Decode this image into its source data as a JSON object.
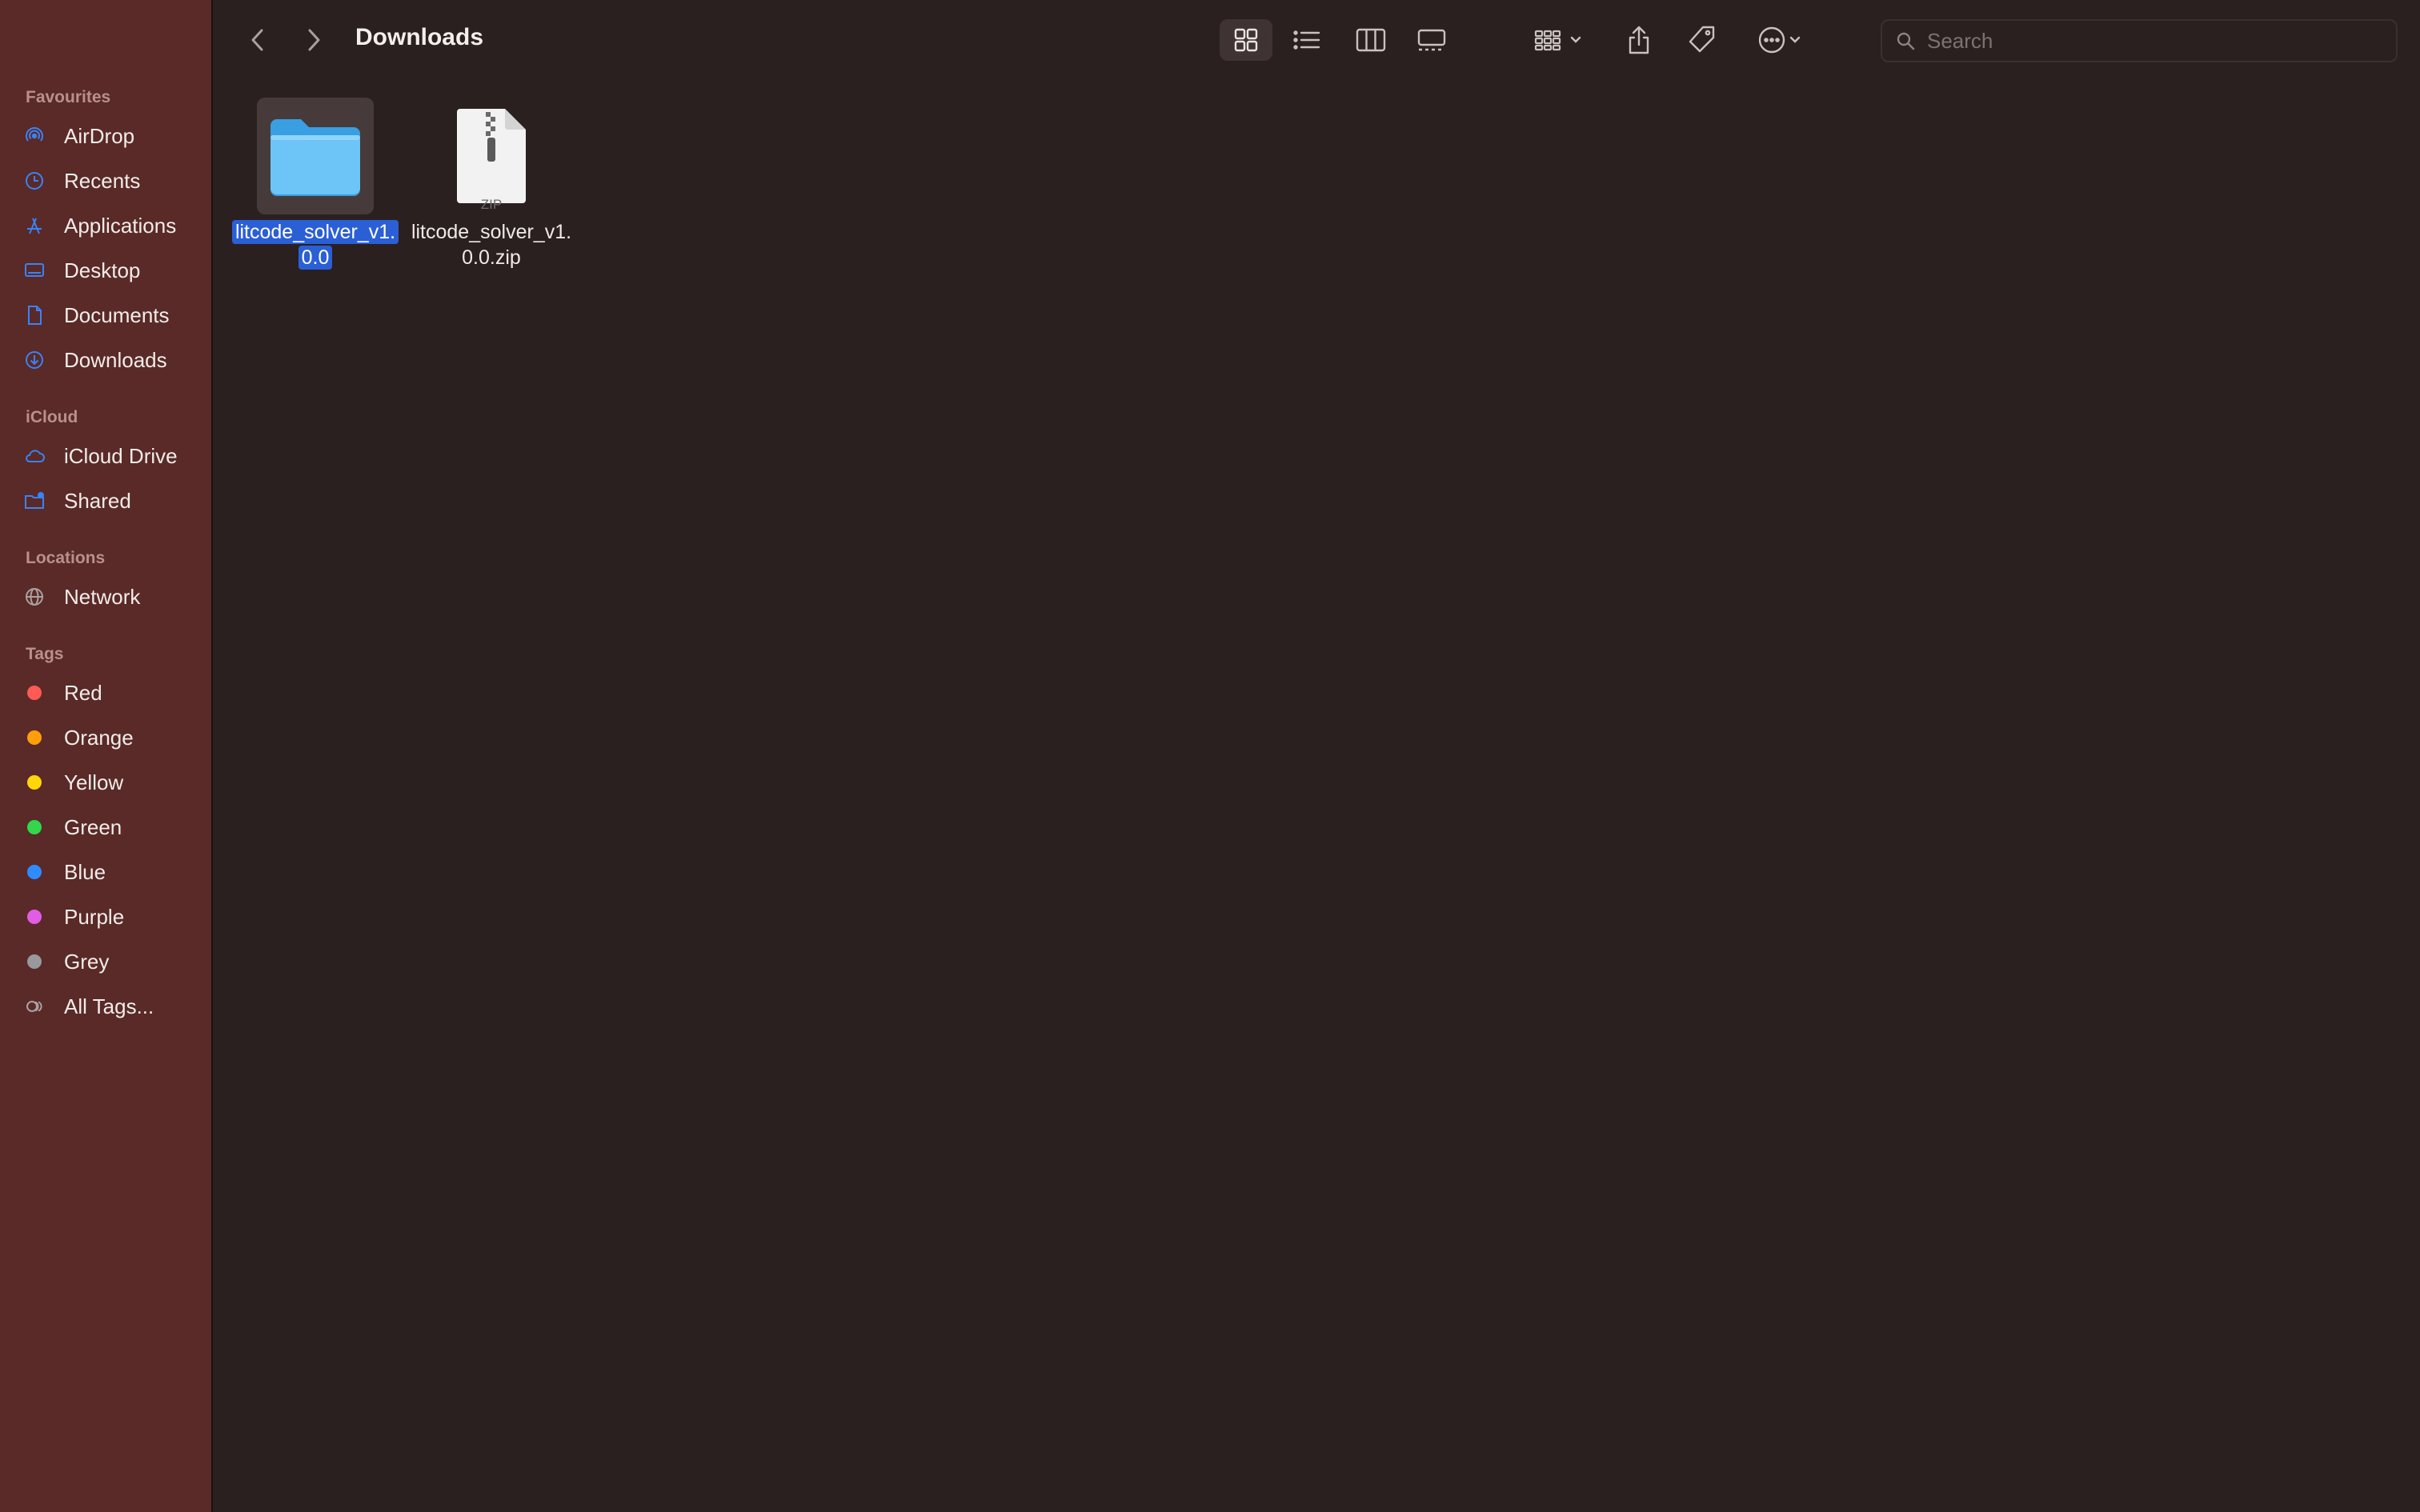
{
  "toolbar": {
    "title": "Downloads",
    "search_placeholder": "Search"
  },
  "sidebar": {
    "favourites": {
      "title": "Favourites",
      "items": [
        {
          "label": "AirDrop",
          "icon": "airdrop-icon"
        },
        {
          "label": "Recents",
          "icon": "clock-icon"
        },
        {
          "label": "Applications",
          "icon": "applications-icon"
        },
        {
          "label": "Desktop",
          "icon": "desktop-icon"
        },
        {
          "label": "Documents",
          "icon": "document-icon"
        },
        {
          "label": "Downloads",
          "icon": "download-icon"
        }
      ]
    },
    "icloud": {
      "title": "iCloud",
      "items": [
        {
          "label": "iCloud Drive",
          "icon": "cloud-icon"
        },
        {
          "label": "Shared",
          "icon": "shared-folder-icon"
        }
      ]
    },
    "locations": {
      "title": "Locations",
      "items": [
        {
          "label": "Network",
          "icon": "globe-icon"
        }
      ]
    },
    "tags": {
      "title": "Tags",
      "items": [
        {
          "label": "Red",
          "color": "#ff5a55"
        },
        {
          "label": "Orange",
          "color": "#ff9f0a"
        },
        {
          "label": "Yellow",
          "color": "#ffd60a"
        },
        {
          "label": "Green",
          "color": "#32d74b"
        },
        {
          "label": "Blue",
          "color": "#2f8cff"
        },
        {
          "label": "Purple",
          "color": "#e35ce6"
        },
        {
          "label": "Grey",
          "color": "#98989d"
        },
        {
          "label": "All Tags...",
          "icon": "all-tags-icon"
        }
      ]
    }
  },
  "files": [
    {
      "name_line1": "litcode_solver_v1.",
      "name_line2": "0.0",
      "type": "folder",
      "selected": true
    },
    {
      "name_line1": "litcode_solver_v1.",
      "name_line2": "0.0.zip",
      "type": "zip",
      "badge": "ZIP",
      "selected": false
    }
  ],
  "colors": {
    "sidebar_bg": "#592a27",
    "content_bg": "#2a201f",
    "accent_icon": "#3b82f6",
    "selection": "#2b5fd6"
  }
}
